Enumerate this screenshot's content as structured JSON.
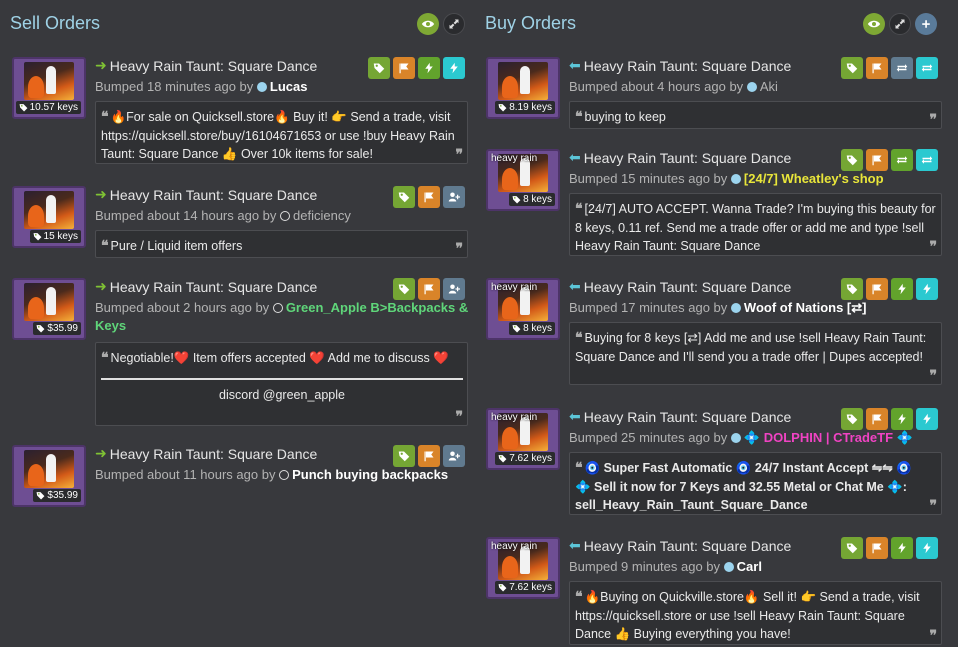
{
  "sell_header": {
    "title": "Sell Orders"
  },
  "buy_header": {
    "title": "Buy Orders"
  },
  "sell": [
    {
      "item": "Heavy Rain Taunt: Square Dance",
      "bumped": "Bumped 18 minutes ago by",
      "user": "Lucas",
      "price": "10.57 keys",
      "effect": "",
      "comment": "🔥For sale on Quicksell.store🔥 Buy it! 👉 Send a trade, visit https://quicksell.store/buy/16104671653 or use !buy Heavy Rain Taunt: Square Dance 👍 Over 10k items for sale!"
    },
    {
      "item": "Heavy Rain Taunt: Square Dance",
      "bumped": "Bumped about 14 hours ago by",
      "user": "deficiency",
      "price": "15 keys",
      "effect": "",
      "comment": "Pure / Liquid item offers"
    },
    {
      "item": "Heavy Rain Taunt: Square Dance",
      "bumped": "Bumped about 2 hours ago by",
      "user": "Green_Apple B>Backpacks &",
      "user2": "Keys",
      "price": "$35.99",
      "effect": "",
      "comment": "Negotiable!❤️ Item offers accepted ❤️ Add me to discuss ❤️",
      "comment_extra": "discord @green_apple"
    },
    {
      "item": "Heavy Rain Taunt: Square Dance",
      "bumped": "Bumped about 11 hours ago by",
      "user": "Punch buying backpacks",
      "price": "$35.99",
      "effect": ""
    }
  ],
  "buy": [
    {
      "item": "Heavy Rain Taunt: Square Dance",
      "bumped": "Bumped about 4 hours ago by",
      "user": "Aki",
      "price": "8.19 keys",
      "effect": "",
      "comment": "buying to keep"
    },
    {
      "item": "Heavy Rain Taunt: Square Dance",
      "bumped": "Bumped 15 minutes ago by",
      "user": "[24/7] Wheatley's shop",
      "price": "8 keys",
      "effect": "heavy rain",
      "comment": "[24/7] AUTO ACCEPT. Wanna Trade? I'm buying this beauty for 8 keys, 0.11 ref. Send me a trade offer or add me and type !sell Heavy Rain Taunt: Square Dance"
    },
    {
      "item": "Heavy Rain Taunt: Square Dance",
      "bumped": "Bumped 17 minutes ago by",
      "user": "Woof of Nations [⇄]",
      "price": "8 keys",
      "effect": "heavy rain",
      "comment": "Buying for 8 keys [⇄] Add me and use !sell Heavy Rain Taunt: Square Dance and I'll send you a trade offer | Dupes accepted!"
    },
    {
      "item": "Heavy Rain Taunt: Square Dance",
      "bumped": "Bumped 25 minutes ago by",
      "user": "💠 DOLPHIN | CTradeTF 💠",
      "price": "7.62 keys",
      "effect": "heavy rain",
      "comment_l1": "🧿 Super Fast Automatic 🧿 24/7 Instant Accept ⇋⇋ 🧿",
      "comment_l2": "💠 Sell it now for 7 Keys and 32.55 Metal or Chat Me 💠:",
      "comment_l3": "sell_Heavy_Rain_Taunt_Square_Dance"
    },
    {
      "item": "Heavy Rain Taunt: Square Dance",
      "bumped": "Bumped 9 minutes ago by",
      "user": "Carl",
      "price": "7.62 keys",
      "effect": "heavy rain",
      "comment": "🔥Buying on Quickville.store🔥 Sell it! 👉 Send a trade, visit https://quicksell.store or use !sell Heavy Rain Taunt: Square Dance 👍 Buying everything you have!"
    }
  ],
  "icons": [
    "eye-icon",
    "expand-icon",
    "plus-icon",
    "tag-icon",
    "flag-icon",
    "bolt-icon",
    "swap-icon",
    "add-friend-icon",
    "quote-icon",
    "key-icon"
  ],
  "colors": {
    "background": "#38393d",
    "title": "#9fd2e6",
    "sell_arrow": "#7fc234",
    "buy_arrow": "#5cc5d8"
  }
}
